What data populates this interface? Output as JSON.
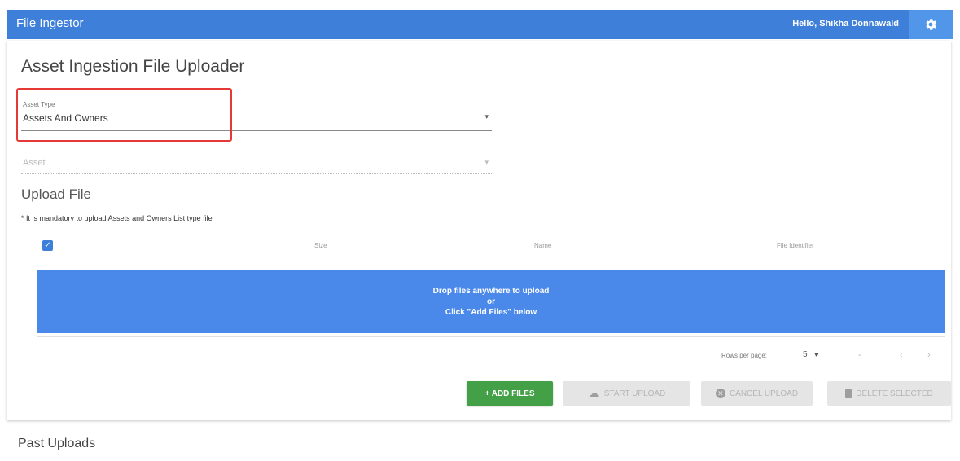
{
  "header": {
    "app_title": "File Ingestor",
    "greeting": "Hello, Shikha Donnawald",
    "settings_icon": "gear-icon"
  },
  "uploader": {
    "title": "Asset Ingestion File Uploader",
    "asset_type": {
      "label": "Asset Type",
      "value": "Assets And Owners"
    },
    "asset": {
      "placeholder": "Asset"
    },
    "upload_section_title": "Upload File",
    "mandatory_note": "* It is mandatory to upload Assets and Owners List type file",
    "table": {
      "columns": [
        "Size",
        "Name",
        "File Identifier"
      ],
      "select_all_checked": true
    },
    "dropzone": {
      "line1": "Drop files anywhere to upload",
      "line2": "or",
      "line3": "Click \"Add Files\" below"
    },
    "pagination": {
      "rows_per_page_label": "Rows per page:",
      "rows_per_page_value": "5",
      "range": "-"
    },
    "buttons": {
      "add_files": "+ ADD FILES",
      "start_upload": "START UPLOAD",
      "cancel_upload": "CANCEL UPLOAD",
      "delete_selected": "DELETE SELECTED"
    }
  },
  "past_uploads": {
    "title": "Past Uploads"
  },
  "colors": {
    "header_bg": "#3d7fd9",
    "dropzone_bg": "#4a88ea",
    "add_button": "#43a047",
    "highlight": "#e53935"
  }
}
